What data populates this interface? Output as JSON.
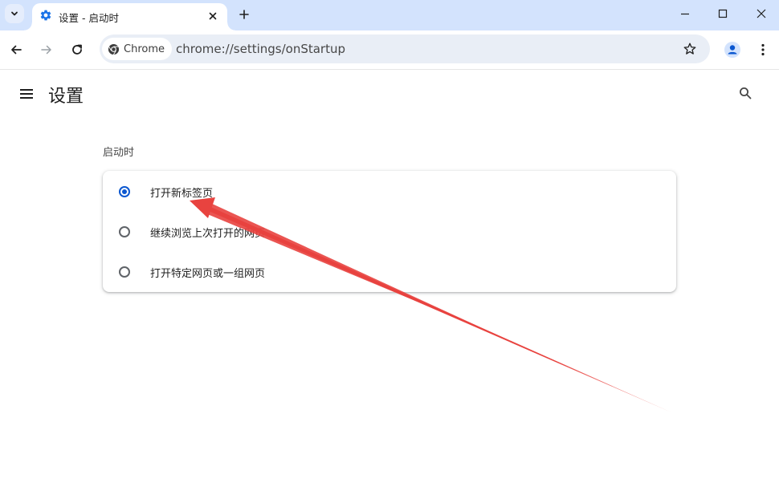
{
  "browser": {
    "tab": {
      "title": "设置 - 启动时",
      "favicon": "gear-icon"
    },
    "window_controls": [
      "minimize-icon",
      "maximize-icon",
      "close-icon"
    ],
    "toolbar": {
      "back": "arrow-left-icon",
      "forward": "arrow-right-icon",
      "reload": "reload-icon",
      "chip_label": "Chrome",
      "url": "chrome://settings/onStartup",
      "bookmark": "star-icon",
      "profile": "profile-icon",
      "menu": "more-vert-icon"
    }
  },
  "settings": {
    "page_title": "设置",
    "section_title": "启动时",
    "options": [
      {
        "label": "打开新标签页",
        "checked": true
      },
      {
        "label": "继续浏览上次打开的网页",
        "checked": false
      },
      {
        "label": "打开特定网页或一组网页",
        "checked": false
      }
    ]
  },
  "annotation": {
    "type": "arrow",
    "color": "#e8433f",
    "points_to": "打开新标签页"
  },
  "colors": {
    "tabstrip_bg": "#d3e3fd",
    "omnibox_bg": "#e9eef6",
    "accent": "#0b57d0"
  }
}
